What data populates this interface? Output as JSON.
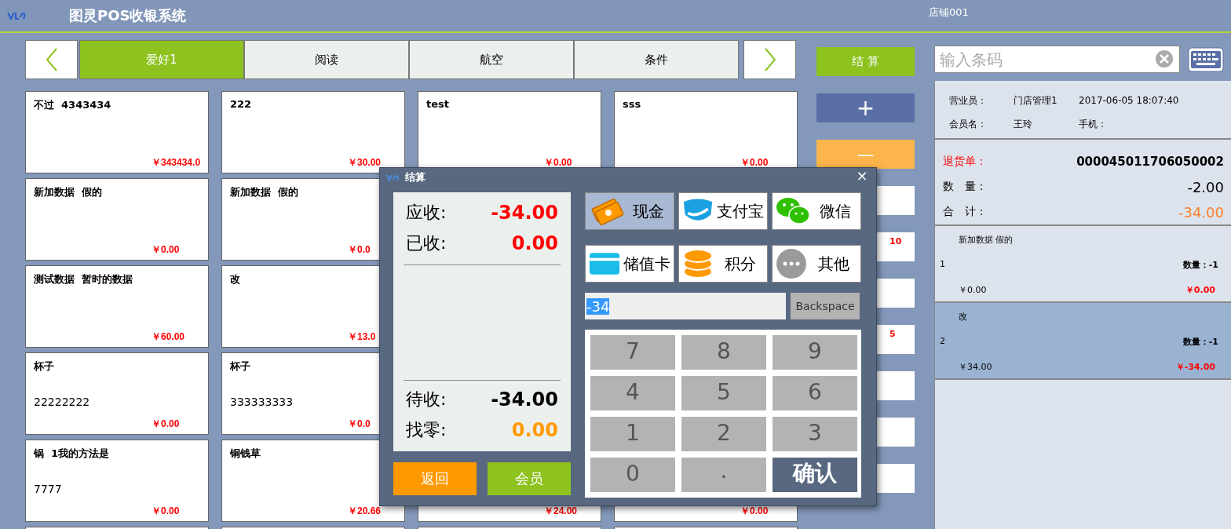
{
  "header": {
    "title": "图灵POS收银系统",
    "store": "店铺001"
  },
  "tabs": [
    {
      "label": "爱好1",
      "selected": true
    },
    {
      "label": "阅读",
      "selected": false
    },
    {
      "label": "航空",
      "selected": false
    },
    {
      "label": "条件",
      "selected": false
    }
  ],
  "products": [
    {
      "name": "不过  4343434",
      "price": "￥343434.0"
    },
    {
      "name": "222",
      "price": "￥30.00"
    },
    {
      "name": "test",
      "price": "￥0.00"
    },
    {
      "name": "sss",
      "price": "￥0.00"
    },
    {
      "name": "新加数据  假的",
      "price": "￥0.00"
    },
    {
      "name": "新加数据  假的",
      "price": "￥0.0"
    },
    {
      "name": "测试数据  暂时的数据",
      "price": "￥60.00"
    },
    {
      "name": "改",
      "price": "￥13.0"
    },
    {
      "name": "杯子",
      "code": "22222222",
      "price": "￥0.00"
    },
    {
      "name": "杯子",
      "code": "333333333",
      "price": "￥0.0"
    },
    {
      "name": "锅  1我的方法是",
      "code": "7777",
      "price": "￥0.00"
    },
    {
      "name": "铜钱草",
      "price": "￥20.66"
    },
    {
      "price": "￥24.00"
    },
    {
      "price": "￥0.00"
    }
  ],
  "side_buttons": [
    {
      "kind": "checkout",
      "label": "结 算"
    },
    {
      "kind": "plus",
      "label": "+"
    },
    {
      "kind": "minus",
      "label": "—"
    },
    {
      "kind": "plain"
    },
    {
      "kind": "plain",
      "badge": "10"
    },
    {
      "kind": "plain"
    },
    {
      "kind": "plain",
      "badge": "5"
    },
    {
      "kind": "plain"
    },
    {
      "kind": "plain"
    },
    {
      "kind": "plain"
    }
  ],
  "barcode": {
    "placeholder": "输入条码"
  },
  "info_rows": [
    [
      "营业员：",
      "门店管理1",
      "2017-06-05 18:07:40"
    ],
    [
      "会员名：",
      "王玲",
      "手机："
    ]
  ],
  "summary": [
    {
      "kind": "order",
      "label": "退货单：",
      "value": "000045011706050002"
    },
    {
      "kind": "qty",
      "label": "数　量：",
      "value": "-2.00"
    },
    {
      "kind": "total",
      "label": "合　计：",
      "value": "-34.00"
    }
  ],
  "order_items": [
    {
      "name": "新加数据  假的",
      "index": "1",
      "quantity": "数量：-1",
      "unit_price": "￥0.00",
      "amount": "￥0.00",
      "selected": false
    },
    {
      "name": "改",
      "index": "2",
      "quantity": "数量：-1",
      "unit_price": "￥34.00",
      "amount": "￥-34.00",
      "selected": true
    }
  ],
  "dialog": {
    "title": "结算",
    "close": "×",
    "received": [
      {
        "label": "应收:",
        "value": "-34.00",
        "color": "#ff0000"
      },
      {
        "label": "已收:",
        "value": "0.00",
        "color": "#ff0000"
      }
    ],
    "outstanding": [
      {
        "label": "待收:",
        "value": "-34.00",
        "color": "#000000"
      },
      {
        "label": "找零:",
        "value": "0.00",
        "color": "#ff9900"
      }
    ],
    "back": "返回",
    "member": "会员",
    "payments": [
      {
        "kind": "cash",
        "label": "现金",
        "selected": true
      },
      {
        "kind": "alipay",
        "label": "支付宝",
        "selected": false
      },
      {
        "kind": "wechat",
        "label": "微信",
        "selected": false
      },
      {
        "kind": "card",
        "label": "储值卡",
        "selected": false
      },
      {
        "kind": "points",
        "label": "积分",
        "selected": false
      },
      {
        "kind": "other",
        "label": "其他",
        "selected": false
      }
    ],
    "amount_field": {
      "value": "-34",
      "highlighted": true
    },
    "backspace": "Backspace",
    "keys": [
      {
        "kind": "digit",
        "label": "7"
      },
      {
        "kind": "digit",
        "label": "8"
      },
      {
        "kind": "digit",
        "label": "9"
      },
      {
        "kind": "digit",
        "label": "4"
      },
      {
        "kind": "digit",
        "label": "5"
      },
      {
        "kind": "digit",
        "label": "6"
      },
      {
        "kind": "digit",
        "label": "1"
      },
      {
        "kind": "digit",
        "label": "2"
      },
      {
        "kind": "digit",
        "label": "3"
      },
      {
        "kind": "digit",
        "label": "0"
      },
      {
        "kind": "decimal",
        "label": "."
      },
      {
        "kind": "confirm",
        "label": "确认"
      }
    ]
  }
}
